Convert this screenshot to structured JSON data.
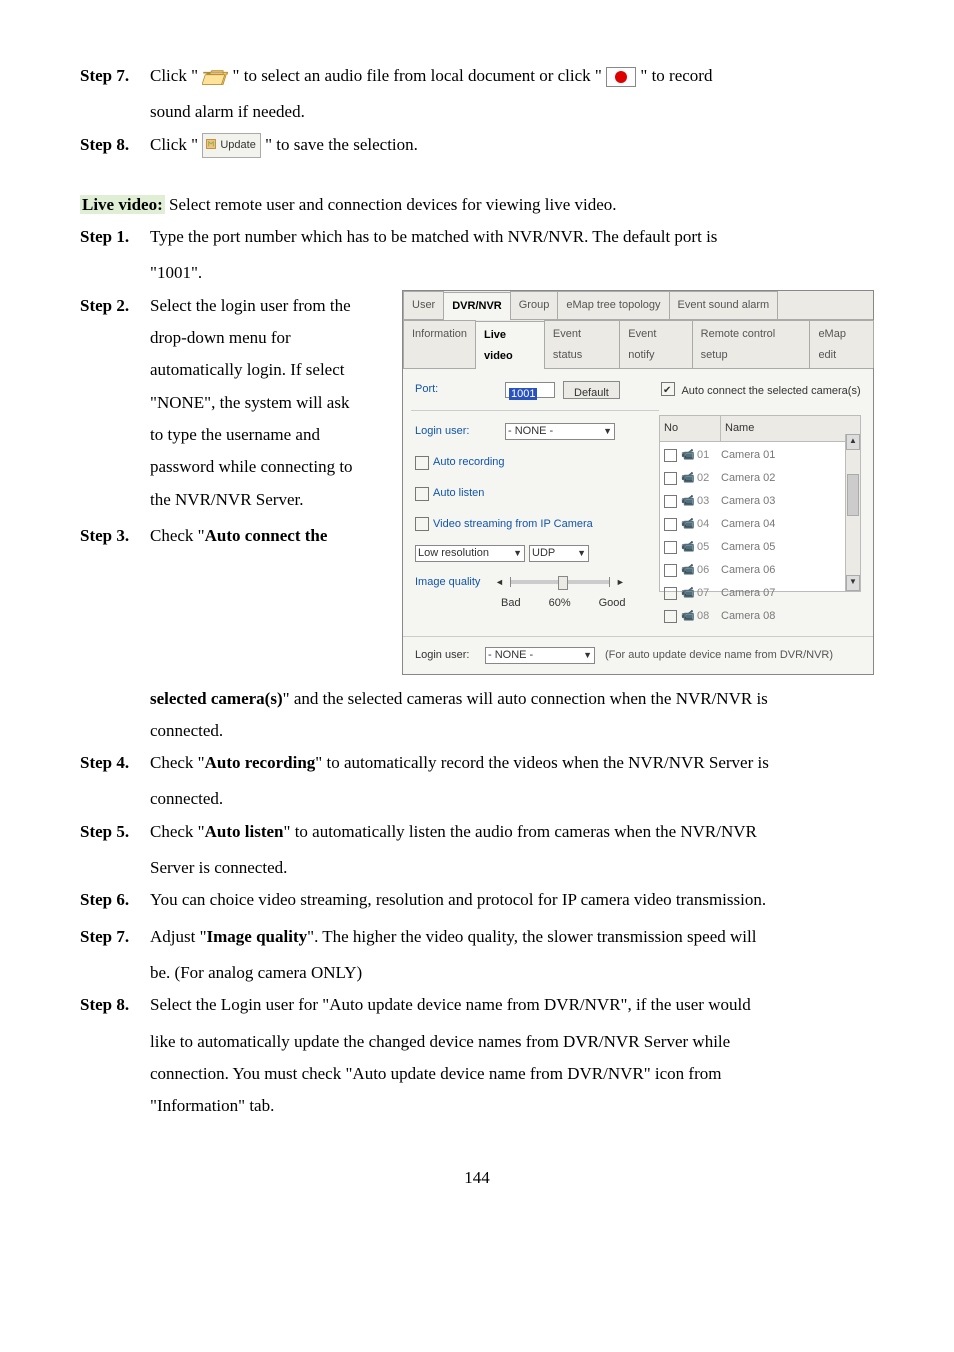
{
  "pre_steps": {
    "s7": {
      "label": "Step 7.",
      "t1": "Click \" ",
      "t2": " \" to select an audio file from local document or click \" ",
      "t3": " \" to record",
      "indent": "sound alarm if needed."
    },
    "s8": {
      "label": "Step 8.",
      "t1": "Click \" ",
      "update_label": "Update",
      "t2": "\" to save the selection."
    }
  },
  "section": {
    "title": "Live video:",
    "desc": " Select remote user and connection devices for viewing live video."
  },
  "steps": {
    "s1": {
      "label": "Step 1.",
      "text": "Type the port number which has to be matched with NVR/NVR. The default port is",
      "indent": "\"1001\"."
    },
    "s2": {
      "label": "Step 2.",
      "lines": [
        "Select the login user from the",
        "drop-down menu for",
        "automatically login. If select",
        "\"NONE\", the system will ask",
        "to type the username and",
        "password while connecting to",
        "the NVR/NVR Server."
      ]
    },
    "s3": {
      "label": "Step 3.",
      "lead": "Check \"",
      "bold1": "Auto connect the",
      "bold2": "selected camera(s)",
      "tail": "\" and the selected cameras will auto connection when the NVR/NVR is",
      "indent": "connected."
    },
    "s4": {
      "label": "Step 4.",
      "lead": "Check \"",
      "bold": "Auto recording",
      "tail": "\" to automatically record the videos when the NVR/NVR Server is",
      "indent": "connected."
    },
    "s5": {
      "label": "Step 5.",
      "lead": "Check \"",
      "bold": "Auto listen",
      "tail": "\" to automatically listen the audio from cameras when the NVR/NVR",
      "indent": "Server is connected."
    },
    "s6": {
      "label": "Step 6.",
      "text": "You can choice video streaming, resolution and protocol for IP camera video transmission."
    },
    "s7": {
      "label": "Step 7.",
      "lead": "Adjust \"",
      "bold": "Image quality",
      "tail": "\". The higher the video quality, the slower transmission speed will",
      "indent": "be. (For analog camera ONLY)"
    },
    "s8": {
      "label": "Step 8.",
      "l1": "Select the Login user for \"Auto update device name from DVR/NVR\", if the user would",
      "l2": "like to automatically update the changed device names from DVR/NVR Server while",
      "l3": "connection.    You must check \"Auto update device name from DVR/NVR\" icon from",
      "l4": "\"Information\" tab."
    }
  },
  "dialog": {
    "outer_tabs": [
      "User",
      "DVR/NVR",
      "Group",
      "eMap tree topology",
      "Event sound alarm"
    ],
    "outer_active": 1,
    "inner_tabs": [
      "Information",
      "Live video",
      "Event status",
      "Event notify",
      "Remote control setup",
      "eMap edit"
    ],
    "inner_active": 1,
    "port_label": "Port:",
    "port_value": "1001",
    "default_btn": "Default",
    "login_label": "Login user:",
    "login_value": "- NONE -",
    "auto_connect": "Auto connect the selected camera(s)",
    "auto_recording": "Auto recording",
    "auto_listen": "Auto listen",
    "video_stream": "Video streaming from IP Camera",
    "resolution_value": "Low resolution",
    "protocol_value": "UDP",
    "image_quality": "Image quality",
    "slider": {
      "bad": "Bad",
      "mid": "60%",
      "good": "Good"
    },
    "cam_head": {
      "no": "No",
      "name": "Name"
    },
    "cameras": [
      {
        "id": "01",
        "name": "Camera 01"
      },
      {
        "id": "02",
        "name": "Camera 02"
      },
      {
        "id": "03",
        "name": "Camera 03"
      },
      {
        "id": "04",
        "name": "Camera 04"
      },
      {
        "id": "05",
        "name": "Camera 05"
      },
      {
        "id": "06",
        "name": "Camera 06"
      },
      {
        "id": "07",
        "name": "Camera 07"
      },
      {
        "id": "08",
        "name": "Camera 08"
      }
    ],
    "footer_login_label": "Login user:",
    "footer_login_value": "- NONE -",
    "footer_note": "(For auto update device name from DVR/NVR)"
  },
  "page_number": "144"
}
